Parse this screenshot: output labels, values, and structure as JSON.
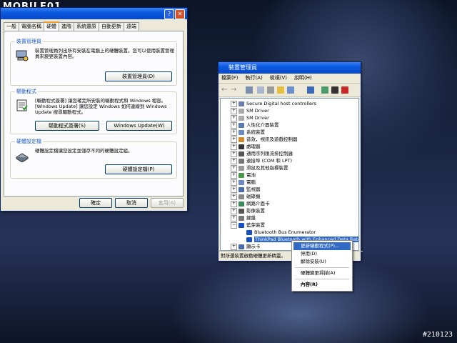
{
  "watermark": "MOBILE01",
  "image_id": "#210123",
  "system_properties": {
    "tabs": [
      "一般",
      "電腦名稱",
      "硬體",
      "進階",
      "系統還原",
      "自動更新",
      "遠端"
    ],
    "active_tab": "硬體",
    "device_manager_group": {
      "title": "裝置管理員",
      "text": "裝置管理員列出所有安裝在電腦上的硬體裝置。您可以使用裝置管理員來變更裝置內容。",
      "button": "裝置管理員(D)"
    },
    "drivers_group": {
      "title": "驅動程式",
      "text": "[驅動程式簽署] 讓您確定所安裝的驅動程式和 Windows 相容。[Windows Update] 讓您設定 Windows 如何連線到 Windows Update 搜尋驅動程式。",
      "button_signing": "驅動程式簽署(S)",
      "button_update": "Windows Update(W)"
    },
    "profiles_group": {
      "title": "硬體設定檔",
      "text": "硬體設定檔讓您設定並儲存不同的硬體設定組。",
      "button": "硬體設定檔(P)"
    },
    "footer": {
      "ok": "確定",
      "cancel": "取消",
      "apply": "套用(A)"
    }
  },
  "device_manager": {
    "title": "裝置管理員",
    "menu": [
      "檔案(F)",
      "執行(A)",
      "檢視(V)",
      "說明(H)"
    ],
    "tree": [
      {
        "label": "Secure Digital host controllers",
        "expander": "+"
      },
      {
        "label": "SM Driver",
        "expander": "+"
      },
      {
        "label": "SM Driver",
        "expander": "+"
      },
      {
        "label": "人性化介面裝置",
        "expander": "+"
      },
      {
        "label": "系統裝置",
        "expander": "+"
      },
      {
        "label": "音效，視訊及遊戲控制器",
        "expander": "+"
      },
      {
        "label": "處理器",
        "expander": "+"
      },
      {
        "label": "通用序列匯流排控制器",
        "expander": "+"
      },
      {
        "label": "連接埠 (COM 和 LPT)",
        "expander": "+"
      },
      {
        "label": "滑鼠及其他指標裝置",
        "expander": "+"
      },
      {
        "label": "電池",
        "expander": "+"
      },
      {
        "label": "電腦",
        "expander": "+"
      },
      {
        "label": "監視器",
        "expander": "+"
      },
      {
        "label": "磁碟機",
        "expander": "+"
      },
      {
        "label": "網路介面卡",
        "expander": "+"
      },
      {
        "label": "影像裝置",
        "expander": "+"
      },
      {
        "label": "鍵盤",
        "expander": "+"
      },
      {
        "label": "藍芽裝置",
        "expander": "−"
      },
      {
        "label": "Bluetooth Bus Enumerator",
        "expander": ""
      },
      {
        "label": "ThinkPad Bluetooth with Enhanced Data Rate",
        "expander": ""
      },
      {
        "label": "顯示卡",
        "expander": "+"
      }
    ],
    "status": "對所選裝置啟動硬體更新精靈。"
  },
  "context_menu": {
    "update_driver": "更新驅動程式(P)...",
    "disable": "停用(D)",
    "uninstall": "解除安裝(U)",
    "scan": "硬體變更掃描(A)",
    "properties": "內容(R)"
  },
  "colors": {
    "title_blue": "#0a5ae0",
    "selection": "#316ac5",
    "window_face": "#ece9d8"
  }
}
